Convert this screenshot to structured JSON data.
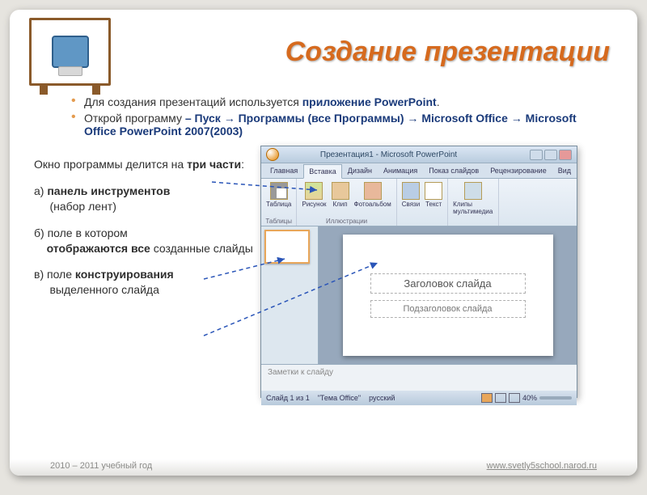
{
  "title": "Создание презентации",
  "bullets": [
    {
      "pre": "Для создания презентаций используется ",
      "strong": "приложение PowerPoint",
      "post": "."
    },
    {
      "pre": "Открой программу ",
      "strong": "– Пуск → Программы (все Программы) → Microsoft Office → Microsoft Office PowerPoint 2007(2003)",
      "post": ""
    }
  ],
  "description": {
    "intro_a": "Окно программы делится на ",
    "intro_b": "три части",
    "a1": "а) ",
    "a2": "панель инструментов",
    "a3": " (набор лент)",
    "b1": "б) поле в котором ",
    "b2": "отображаются все ",
    "b3": "созданные слайды",
    "c1": "в) поле ",
    "c2": "конструирования",
    "c3": " выделенного слайда"
  },
  "pp": {
    "title": "Презентация1 - Microsoft PowerPoint",
    "tabs": [
      "Главная",
      "Вставка",
      "Дизайн",
      "Анимация",
      "Показ слайдов",
      "Рецензирование",
      "Вид"
    ],
    "groups": {
      "g1": {
        "label": "Таблицы",
        "btn": "Таблица"
      },
      "g2": {
        "label": "Иллюстрации",
        "btns": [
          "Рисунок",
          "Клип",
          "Фотоальбом"
        ]
      },
      "g3": {
        "label": "",
        "btns": [
          "Связи",
          "Текст"
        ]
      },
      "g4": {
        "label": "",
        "btn": "Клипы мультимедиа"
      }
    },
    "slide_title": "Заголовок слайда",
    "slide_sub": "Подзаголовок слайда",
    "notes": "Заметки к слайду",
    "status_slide": "Слайд 1 из 1",
    "status_theme": "\"Тема Office\"",
    "status_lang": "русский",
    "status_zoom": "40%"
  },
  "footer": {
    "left": "2010 – 2011 учебный год",
    "right": "www.svetly5school.narod.ru"
  }
}
